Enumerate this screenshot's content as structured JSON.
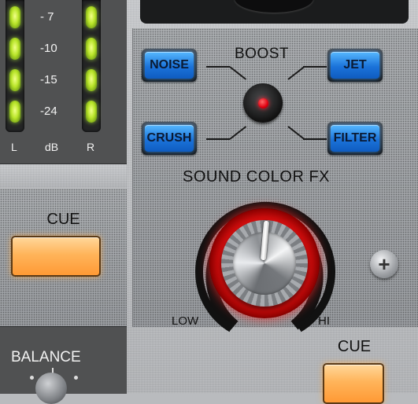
{
  "meters": {
    "scale": [
      "- 7",
      "-10",
      "-15",
      "-24"
    ],
    "left_label": "L",
    "unit_label": "dB",
    "right_label": "R",
    "left_level": 4,
    "right_level": 4
  },
  "cue_left": {
    "label": "CUE"
  },
  "balance": {
    "label": "BALANCE"
  },
  "fx": {
    "boost_label": "BOOST",
    "buttons": [
      "NOISE",
      "JET",
      "CRUSH",
      "FILTER"
    ],
    "section_title": "SOUND COLOR FX",
    "low_label": "LOW",
    "hi_label": "HI",
    "boost_led_color": "#e00010",
    "button_color": "#1b73da"
  },
  "cue_right": {
    "label": "CUE"
  }
}
